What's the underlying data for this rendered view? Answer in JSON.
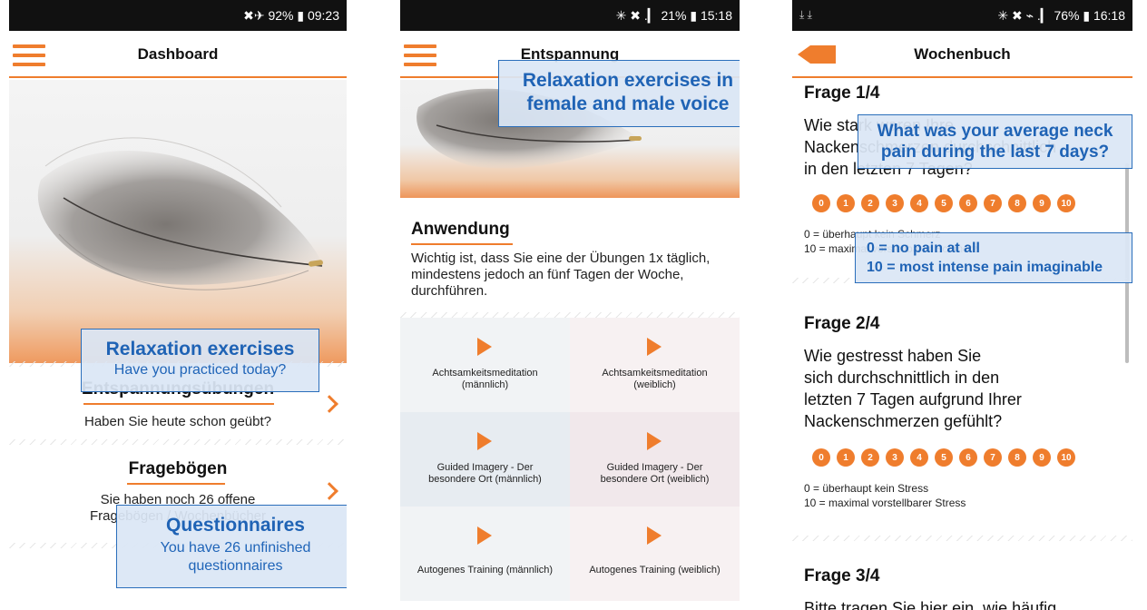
{
  "screen1": {
    "status": "✖✈ 92% ▮ 09:23",
    "title": "Dashboard",
    "relax_title": "Entspannungsübungen",
    "relax_sub": "Haben Sie heute schon geübt?",
    "quest_title": "Fragebögen",
    "quest_sub_line1": "Sie haben noch 26 offene",
    "quest_sub_line2": "Fragebögen / Wochenbücher",
    "overlay_relax_title": "Relaxation exercises",
    "overlay_relax_sub": "Have you practiced today?",
    "overlay_quest_title": "Questionnaires",
    "overlay_quest_sub_line1": "You have 26 unfinished",
    "overlay_quest_sub_line2": "questionnaires"
  },
  "screen2": {
    "status": "✳ ✖ .▎ 21% ▮ 15:18",
    "title": "Entspannung",
    "section_title": "Anwendung",
    "section_text": "Wichtig ist, dass Sie eine der Übungen 1x täglich, mindestens jedoch an fünf Tagen der Woche, durchführen.",
    "overlay_line1": "Relaxation exercises in",
    "overlay_line2": "female and male voice",
    "exercises": [
      {
        "line1": "Achtsamkeitsmeditation",
        "line2": "(männlich)"
      },
      {
        "line1": "Achtsamkeitsmeditation",
        "line2": "(weiblich)"
      },
      {
        "line1": "Guided Imagery - Der",
        "line2": "besondere Ort (männlich)"
      },
      {
        "line1": "Guided Imagery - Der",
        "line2": "besondere Ort (weiblich)"
      },
      {
        "line1": "Autogenes Training (männlich)",
        "line2": ""
      },
      {
        "line1": "Autogenes Training (weiblich)",
        "line2": ""
      }
    ]
  },
  "screen3": {
    "status_left": "⤓ ⤓",
    "status": "✳ ✖ ⌁ .▎ 76% ▮ 16:18",
    "title": "Wochenbuch",
    "q1_label": "Frage 1/4",
    "q1_line1": "Wie stark waren Ihre",
    "q1_line2": "Nackenschmerzen durchschnittlich",
    "q1_line3": "in den letzten 7 Tagen?",
    "q1_legend0": "0 = überhaupt kein Schmerz",
    "q1_legend10": "10 = maximal vorstellbarer Schmerz",
    "q2_label": "Frage 2/4",
    "q2_line1": "Wie gestresst haben Sie",
    "q2_line2": "sich durchschnittlich in den",
    "q2_line3": "letzten 7 Tagen aufgrund Ihrer",
    "q2_line4": "Nackenschmerzen gefühlt?",
    "q2_legend0": "0 = überhaupt kein Stress",
    "q2_legend10": "10 = maximal vorstellbarer Stress",
    "q3_label": "Frage 3/4",
    "q3_line1": "Bitte tragen Sie hier ein, wie häufig",
    "scale": [
      "0",
      "1",
      "2",
      "3",
      "4",
      "5",
      "6",
      "7",
      "8",
      "9",
      "10"
    ],
    "overlay_q_line1": "What was your average neck",
    "overlay_q_line2": "pain during the last 7 days?",
    "overlay_scale_line1": "0 = no pain at all",
    "overlay_scale_line2": "10 = most intense pain imaginable"
  },
  "colors": {
    "accent": "#ef7d2d",
    "overlay_border": "#2a6ebb",
    "overlay_text": "#1f63b5"
  }
}
